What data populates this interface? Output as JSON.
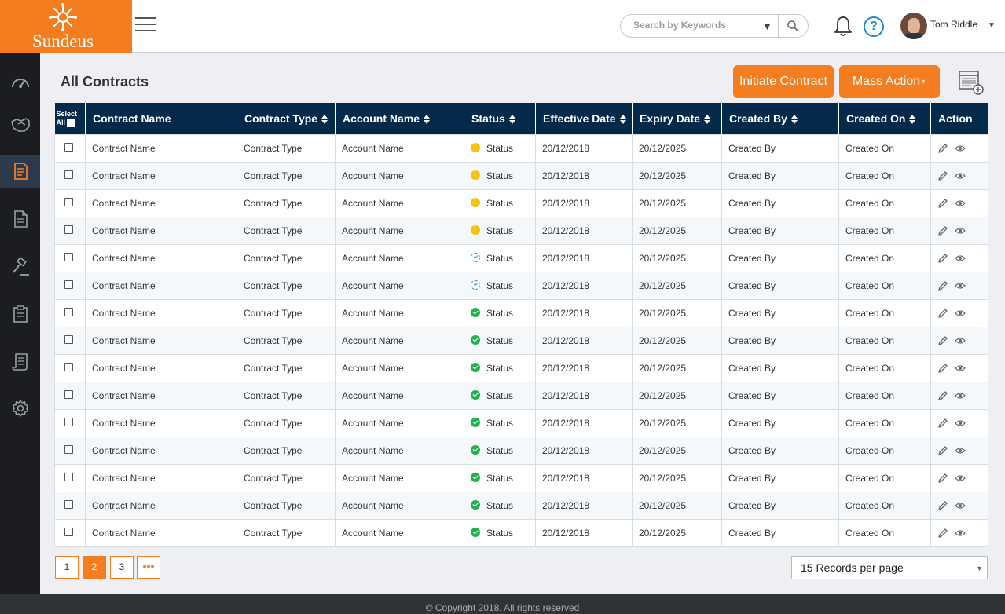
{
  "brand": {
    "name": "Sundeus",
    "color": "#f47d20"
  },
  "header": {
    "search_placeholder": "Search by Keywords",
    "user_name": "Tom Riddle",
    "help_symbol": "?",
    "caret": "▼",
    "user_caret": "▼"
  },
  "sidebar": {
    "items": [
      {
        "icon": "dashboard-icon",
        "active": false
      },
      {
        "icon": "handshake-icon",
        "active": false
      },
      {
        "icon": "contracts-icon",
        "active": true
      },
      {
        "icon": "document-icon",
        "active": false
      },
      {
        "icon": "gavel-icon",
        "active": false
      },
      {
        "icon": "clipboard-icon",
        "active": false
      },
      {
        "icon": "scroll-icon",
        "active": false
      },
      {
        "icon": "settings-icon",
        "active": false
      }
    ]
  },
  "main": {
    "title": "All Contracts",
    "initiate_label": "Initiate Contract",
    "mass_label": "Mass Action",
    "mass_caret": "▼"
  },
  "table": {
    "select_all_line1": "Select",
    "select_all_line2": "All",
    "columns": [
      "Contract Name",
      "Contract Type",
      "Account Name",
      "Status",
      "Effective Date",
      "Expiry Date",
      "Created By",
      "Created On",
      "Action"
    ],
    "status_colors": {
      "warning": "#f4c20d",
      "in_progress": "#2f8fd9",
      "complete": "#23b14d"
    },
    "rows": [
      {
        "name": "Contract Name",
        "type": "Contract Type",
        "account": "Account Name",
        "status": "Status",
        "status_icon": "warning",
        "effective": "20/12/2018",
        "expiry": "20/12/2025",
        "created_by": "Created By",
        "created_on": "Created On"
      },
      {
        "name": "Contract Name",
        "type": "Contract Type",
        "account": "Account Name",
        "status": "Status",
        "status_icon": "warning",
        "effective": "20/12/2018",
        "expiry": "20/12/2025",
        "created_by": "Created By",
        "created_on": "Created On"
      },
      {
        "name": "Contract Name",
        "type": "Contract Type",
        "account": "Account Name",
        "status": "Status",
        "status_icon": "warning",
        "effective": "20/12/2018",
        "expiry": "20/12/2025",
        "created_by": "Created By",
        "created_on": "Created On"
      },
      {
        "name": "Contract Name",
        "type": "Contract Type",
        "account": "Account Name",
        "status": "Status",
        "status_icon": "warning",
        "effective": "20/12/2018",
        "expiry": "20/12/2025",
        "created_by": "Created By",
        "created_on": "Created On"
      },
      {
        "name": "Contract Name",
        "type": "Contract Type",
        "account": "Account Name",
        "status": "Status",
        "status_icon": "in_progress",
        "effective": "20/12/2018",
        "expiry": "20/12/2025",
        "created_by": "Created By",
        "created_on": "Created On"
      },
      {
        "name": "Contract Name",
        "type": "Contract Type",
        "account": "Account Name",
        "status": "Status",
        "status_icon": "in_progress",
        "effective": "20/12/2018",
        "expiry": "20/12/2025",
        "created_by": "Created By",
        "created_on": "Created On"
      },
      {
        "name": "Contract Name",
        "type": "Contract Type",
        "account": "Account Name",
        "status": "Status",
        "status_icon": "complete",
        "effective": "20/12/2018",
        "expiry": "20/12/2025",
        "created_by": "Created By",
        "created_on": "Created On"
      },
      {
        "name": "Contract Name",
        "type": "Contract Type",
        "account": "Account Name",
        "status": "Status",
        "status_icon": "complete",
        "effective": "20/12/2018",
        "expiry": "20/12/2025",
        "created_by": "Created By",
        "created_on": "Created On"
      },
      {
        "name": "Contract Name",
        "type": "Contract Type",
        "account": "Account Name",
        "status": "Status",
        "status_icon": "complete",
        "effective": "20/12/2018",
        "expiry": "20/12/2025",
        "created_by": "Created By",
        "created_on": "Created On"
      },
      {
        "name": "Contract Name",
        "type": "Contract Type",
        "account": "Account Name",
        "status": "Status",
        "status_icon": "complete",
        "effective": "20/12/2018",
        "expiry": "20/12/2025",
        "created_by": "Created By",
        "created_on": "Created On"
      },
      {
        "name": "Contract Name",
        "type": "Contract Type",
        "account": "Account Name",
        "status": "Status",
        "status_icon": "complete",
        "effective": "20/12/2018",
        "expiry": "20/12/2025",
        "created_by": "Created By",
        "created_on": "Created On"
      },
      {
        "name": "Contract Name",
        "type": "Contract Type",
        "account": "Account Name",
        "status": "Status",
        "status_icon": "complete",
        "effective": "20/12/2018",
        "expiry": "20/12/2025",
        "created_by": "Created By",
        "created_on": "Created On"
      },
      {
        "name": "Contract Name",
        "type": "Contract Type",
        "account": "Account Name",
        "status": "Status",
        "status_icon": "complete",
        "effective": "20/12/2018",
        "expiry": "20/12/2025",
        "created_by": "Created By",
        "created_on": "Created On"
      },
      {
        "name": "Contract Name",
        "type": "Contract Type",
        "account": "Account Name",
        "status": "Status",
        "status_icon": "complete",
        "effective": "20/12/2018",
        "expiry": "20/12/2025",
        "created_by": "Created By",
        "created_on": "Created On"
      },
      {
        "name": "Contract Name",
        "type": "Contract Type",
        "account": "Account Name",
        "status": "Status",
        "status_icon": "complete",
        "effective": "20/12/2018",
        "expiry": "20/12/2025",
        "created_by": "Created By",
        "created_on": "Created On"
      }
    ]
  },
  "pagination": {
    "pages": [
      "1",
      "2",
      "3"
    ],
    "active_page": "2",
    "more_label": "•••",
    "per_page_label": "15 Records per page",
    "per_page_caret": "▼"
  },
  "footer": {
    "copyright": "© Copyright 2018. All rights reserved"
  }
}
